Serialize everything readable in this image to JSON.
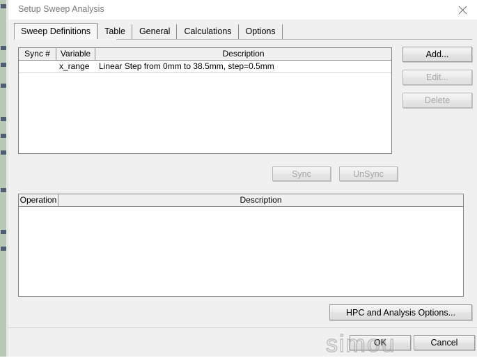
{
  "window": {
    "title": "Setup Sweep Analysis",
    "close_icon": "close-icon"
  },
  "tabs": [
    {
      "label": "Sweep Definitions",
      "active": true
    },
    {
      "label": "Table",
      "active": false
    },
    {
      "label": "General",
      "active": false
    },
    {
      "label": "Calculations",
      "active": false
    },
    {
      "label": "Options",
      "active": false
    }
  ],
  "sweep_table": {
    "columns": [
      "Sync #",
      "Variable",
      "Description"
    ],
    "rows": [
      {
        "sync": "",
        "variable": "x_range",
        "description": "Linear Step from 0mm to 38.5mm, step=0.5mm"
      }
    ]
  },
  "side_buttons": [
    {
      "label": "Add...",
      "disabled": false
    },
    {
      "label": "Edit...",
      "disabled": true
    },
    {
      "label": "Delete",
      "disabled": true
    }
  ],
  "sync_buttons": [
    {
      "label": "Sync",
      "disabled": true
    },
    {
      "label": "UnSync",
      "disabled": true
    }
  ],
  "operation_table": {
    "columns": [
      "Operation",
      "Description"
    ],
    "rows": []
  },
  "options_button": {
    "label": "HPC and Analysis Options..."
  },
  "footer_buttons": [
    {
      "label": "OK"
    },
    {
      "label": "Cancel"
    }
  ],
  "watermark": {
    "text": "simou"
  },
  "colors": {
    "window_bg": "#f0f0f0",
    "titlebar_bg": "#ffffff",
    "title_text": "#7a7a7a",
    "listview_bg": "#ffffff",
    "listview_border": "#828282",
    "disabled_text": "#a6a6a6",
    "sliver_bg": "#b9c8b6"
  }
}
